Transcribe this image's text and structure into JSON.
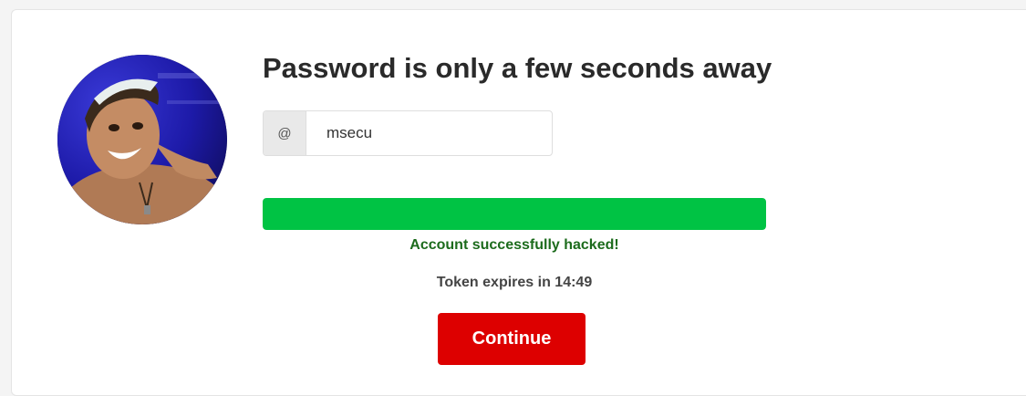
{
  "header": {
    "title": "Password is only a few seconds away"
  },
  "username_field": {
    "addon_symbol": "@",
    "value": "msecu"
  },
  "progress": {
    "percent": 100,
    "color": "#00c344"
  },
  "status_text": "Account successfully hacked!",
  "token_text": "Token expires in 14:49",
  "continue_button": {
    "label": "Continue",
    "color": "#dd0000"
  },
  "avatar": {
    "icon": "profile-photo"
  }
}
